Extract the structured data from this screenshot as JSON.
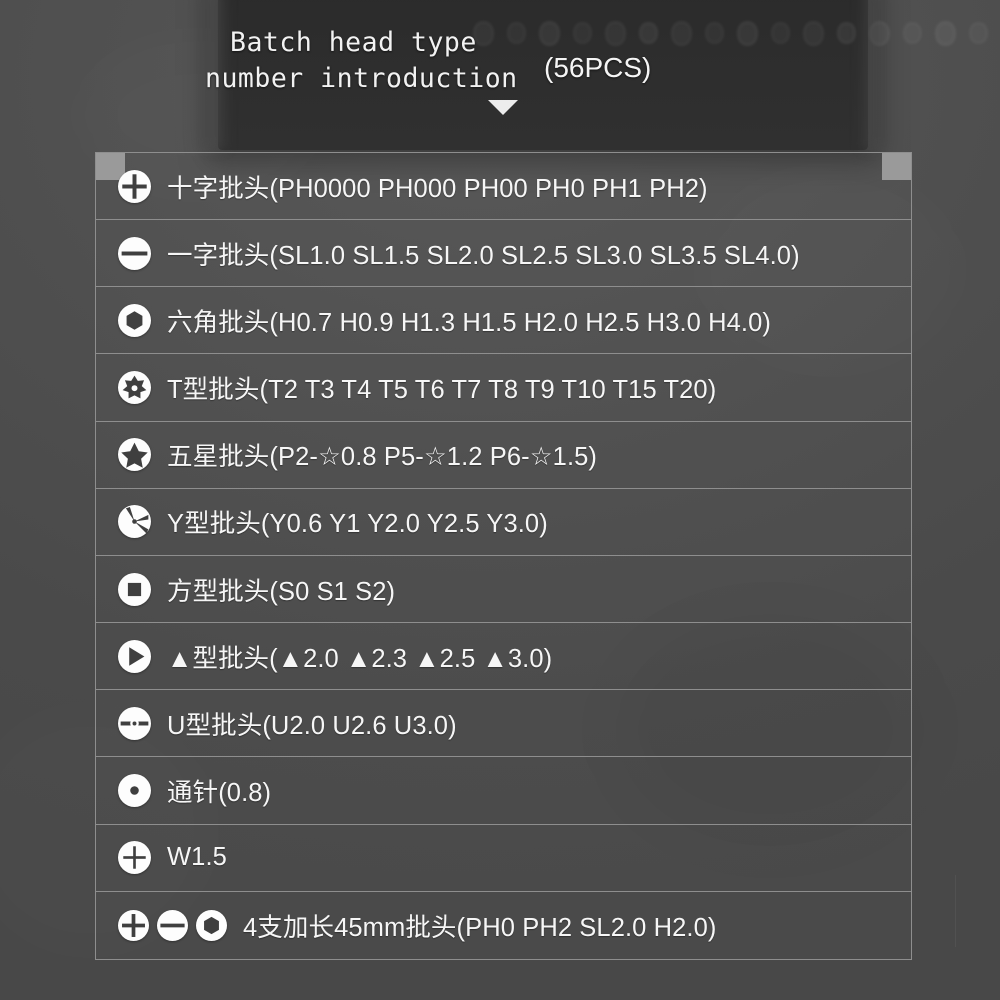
{
  "banner": {
    "title_line1": "Batch head type",
    "title_line2": "number introduction",
    "count_label": "(56PCS)",
    "arrow_icon": "triangle-down-icon",
    "bg_color": "#2e2e2e",
    "text_color": "#f2f2f2"
  },
  "page": {
    "background_color": "#4d4d4d",
    "table_border_color": "#8e8e8e",
    "corner_marker_color": "#9a9a9a"
  },
  "table": {
    "rows": [
      {
        "icons": [
          "phillips-cross-icon"
        ],
        "text": "十字批头(PH0000 PH000 PH00 PH0 PH1 PH2)"
      },
      {
        "icons": [
          "slotted-minus-icon"
        ],
        "text": "一字批头(SL1.0 SL1.5 SL2.0 SL2.5 SL3.0 SL3.5 SL4.0)"
      },
      {
        "icons": [
          "hex-icon"
        ],
        "text": "六角批头(H0.7 H0.9 H1.3 H1.5 H2.0 H2.5 H3.0 H4.0)"
      },
      {
        "icons": [
          "torx-star-icon"
        ],
        "text": "T型批头(T2 T3 T4 T5 T6 T7 T8 T9 T10 T15 T20)"
      },
      {
        "icons": [
          "pentalobe-star-icon"
        ],
        "text": "五星批头(P2-☆0.8  P5-☆1.2  P6-☆1.5)"
      },
      {
        "icons": [
          "tri-wing-y-icon"
        ],
        "text": "Y型批头(Y0.6 Y1 Y2.0 Y2.5 Y3.0)"
      },
      {
        "icons": [
          "square-icon"
        ],
        "text": "方型批头(S0 S1 S2)"
      },
      {
        "icons": [
          "triangle-icon"
        ],
        "text": "▲型批头(▲2.0 ▲2.3 ▲2.5 ▲3.0)"
      },
      {
        "icons": [
          "u-fork-icon"
        ],
        "text": "U型批头(U2.0 U2.6 U3.0)"
      },
      {
        "icons": [
          "pin-dot-icon"
        ],
        "text": "通针(0.8)"
      },
      {
        "icons": [
          "cross-thin-icon"
        ],
        "text": "W1.5"
      },
      {
        "icons": [
          "phillips-cross-icon",
          "slotted-minus-icon",
          "hex-icon"
        ],
        "text": "4支加长45mm批头(PH0 PH2 SL2.0 H2.0)"
      }
    ]
  }
}
